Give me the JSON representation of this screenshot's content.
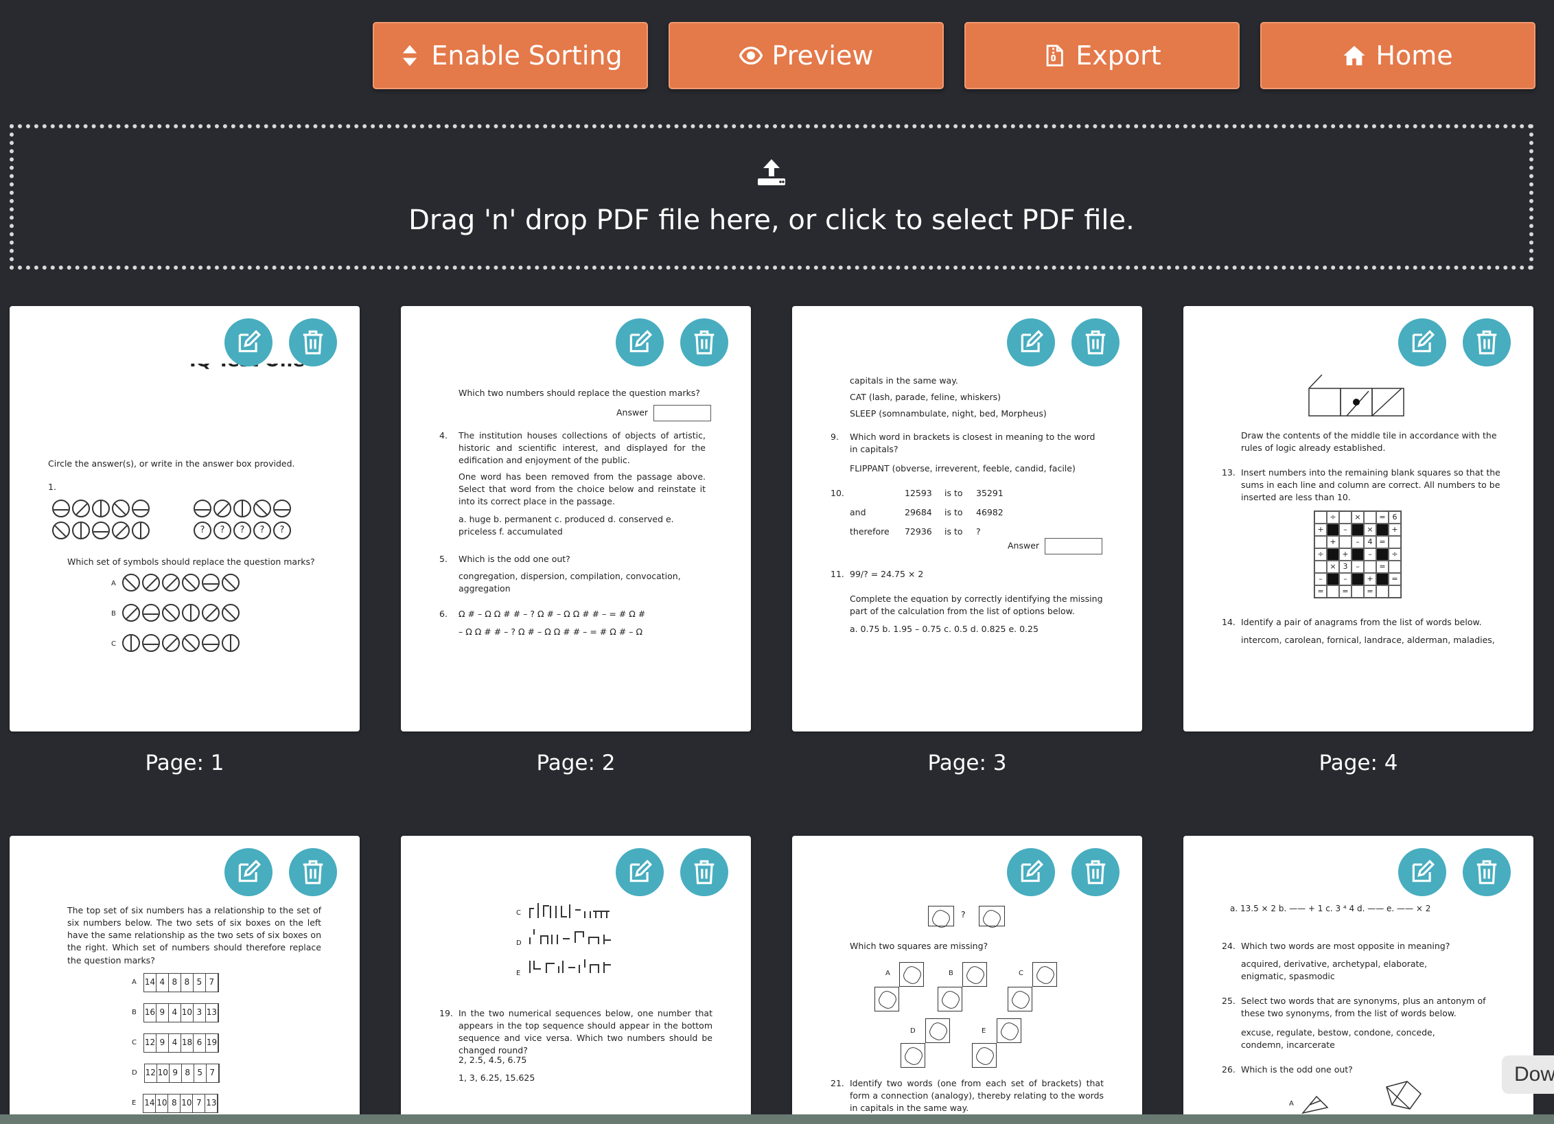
{
  "toolbar": {
    "sorting": {
      "label": "Enable Sorting",
      "icon": "sort-icon"
    },
    "preview": {
      "label": "Preview",
      "icon": "eye-icon"
    },
    "export": {
      "label": "Export",
      "icon": "file-zip-icon"
    },
    "home": {
      "label": "Home",
      "icon": "home-icon"
    }
  },
  "dropzone": {
    "text": "Drag 'n' drop PDF file here, or click to select PDF file.",
    "icon": "upload-icon"
  },
  "pages": [
    {
      "label": "Page: 1"
    },
    {
      "label": "Page: 2"
    },
    {
      "label": "Page: 3"
    },
    {
      "label": "Page: 4"
    }
  ],
  "page1": {
    "title": "IQ Test One",
    "instruction": "Circle the answer(s), or write in the answer box provided.",
    "q1": "1.",
    "question": "Which set of symbols should replace the question marks?",
    "opts": [
      "A",
      "B",
      "C"
    ]
  },
  "page2": {
    "top": "Which two numbers should replace the question marks?",
    "answer": "Answer",
    "q4n": "4.",
    "q4": "The institution houses collections of objects of artistic, historic and scientific interest, and displayed for the edification and enjoyment of the public.",
    "q4b": "One word has been removed from the passage above. Select that word from the choice below and reinstate it into its correct place in the passage.",
    "q4c": "a. huge b. permanent c. produced d. conserved e. priceless f. accumulated",
    "q5n": "5.",
    "q5": "Which is the odd one out?",
    "q5a": "congregation, dispersion, compilation, convocation, aggregation",
    "q6n": "6.",
    "q6a": "Ω # – Ω Ω # # – ?  Ω # –  Ω Ω # # – = #  Ω #",
    "q6b": "– Ω Ω # # – ?  Ω # – Ω Ω # # – = #  Ω # – Ω"
  },
  "page3": {
    "l1": "capitals in the same way.",
    "l2": "CAT (lash, parade, feline, whiskers)",
    "l3": "SLEEP (somnambulate, night, bed, Morpheus)",
    "q9n": "9.",
    "q9": "Which word in brackets is closest in meaning to the word in capitals?",
    "q9a": "FLIPPANT (obverse, irreverent, feeble, candid, facile)",
    "q10n": "10.",
    "r1": [
      "12593",
      "is to",
      "35291"
    ],
    "r2": [
      "and",
      "29684",
      "is to",
      "46982"
    ],
    "r3": [
      "therefore",
      "72936",
      "is to",
      "?"
    ],
    "answer": "Answer",
    "q11n": "11.",
    "q11": "99/? = 24.75 × 2",
    "q11a": "Complete the equation by correctly identifying the missing part of the calculation from the list of options below.",
    "q11b": "a. 0.75    b. 1.95 – 0.75    c. 0.5    d. 0.825    e. 0.25"
  },
  "page4": {
    "top": "Draw the contents of the middle tile in accordance with the rules of logic already established.",
    "q13n": "13.",
    "q13": "Insert numbers into the remaining blank squares so that the sums in each line and column are correct. All numbers to be inserted are less than 10.",
    "q14n": "14.",
    "q14": "Identify a pair of anagrams from the list of words below.",
    "q14a": "intercom, carolean, fornical, landrace, alderman, maladies,"
  },
  "page5": {
    "text": "The top set of six numbers has a relationship to the set of six numbers below. The two sets of six boxes on the left have the same relationship as the two sets of six boxes on the right. Which set of numbers should therefore replace the question marks?",
    "rows": [
      {
        "letter": "A",
        "nums": [
          "14",
          "4",
          "8",
          "8",
          "5",
          "7"
        ]
      },
      {
        "letter": "B",
        "nums": [
          "16",
          "9",
          "4",
          "10",
          "3",
          "13"
        ]
      },
      {
        "letter": "C",
        "nums": [
          "12",
          "9",
          "4",
          "18",
          "6",
          "19"
        ]
      },
      {
        "letter": "D",
        "nums": [
          "12",
          "10",
          "9",
          "8",
          "5",
          "7"
        ]
      },
      {
        "letter": "E",
        "nums": [
          "14",
          "10",
          "8",
          "10",
          "7",
          "13"
        ]
      }
    ]
  },
  "page6": {
    "letters": [
      "C",
      "D",
      "E"
    ],
    "q19n": "19.",
    "q19": "In the two numerical sequences below, one number that appears in the top sequence should appear in the bottom sequence and vice versa. Which two numbers should be changed round?",
    "s1": "2, 2.5, 4.5, 6.75",
    "s2": "1, 3, 6.25, 15.625"
  },
  "page7": {
    "q": "Which two squares are missing?",
    "q_mark": "?",
    "letters": [
      "A",
      "B",
      "C",
      "D",
      "E"
    ],
    "q21n": "21.",
    "q21": "Identify two words (one from each set of brackets) that form a connection (analogy), thereby relating to the words in capitals in the same way."
  },
  "page8": {
    "top": "a. 13.5 × 2   b.  —— + 1   c. 3 ⁴ 4   d.  ——   e.  —— × 2",
    "q24n": "24.",
    "q24": "Which two words are most opposite in meaning?",
    "q24a": "acquired, derivative, archetypal, elaborate, enigmatic, spasmodic",
    "q25n": "25.",
    "q25": "Select two words that are synonyms, plus an antonym of these two synonyms, from the list of words below.",
    "q25a": "excuse, regulate, bestow, condone, concede, condemn, incarcerate",
    "q26n": "26.",
    "q26": "Which is the odd one out?",
    "q26l": "A"
  },
  "sidetab": "Dow",
  "colors": {
    "background": "#282a2f",
    "accent": "#e4794a",
    "action": "#47adbf"
  }
}
